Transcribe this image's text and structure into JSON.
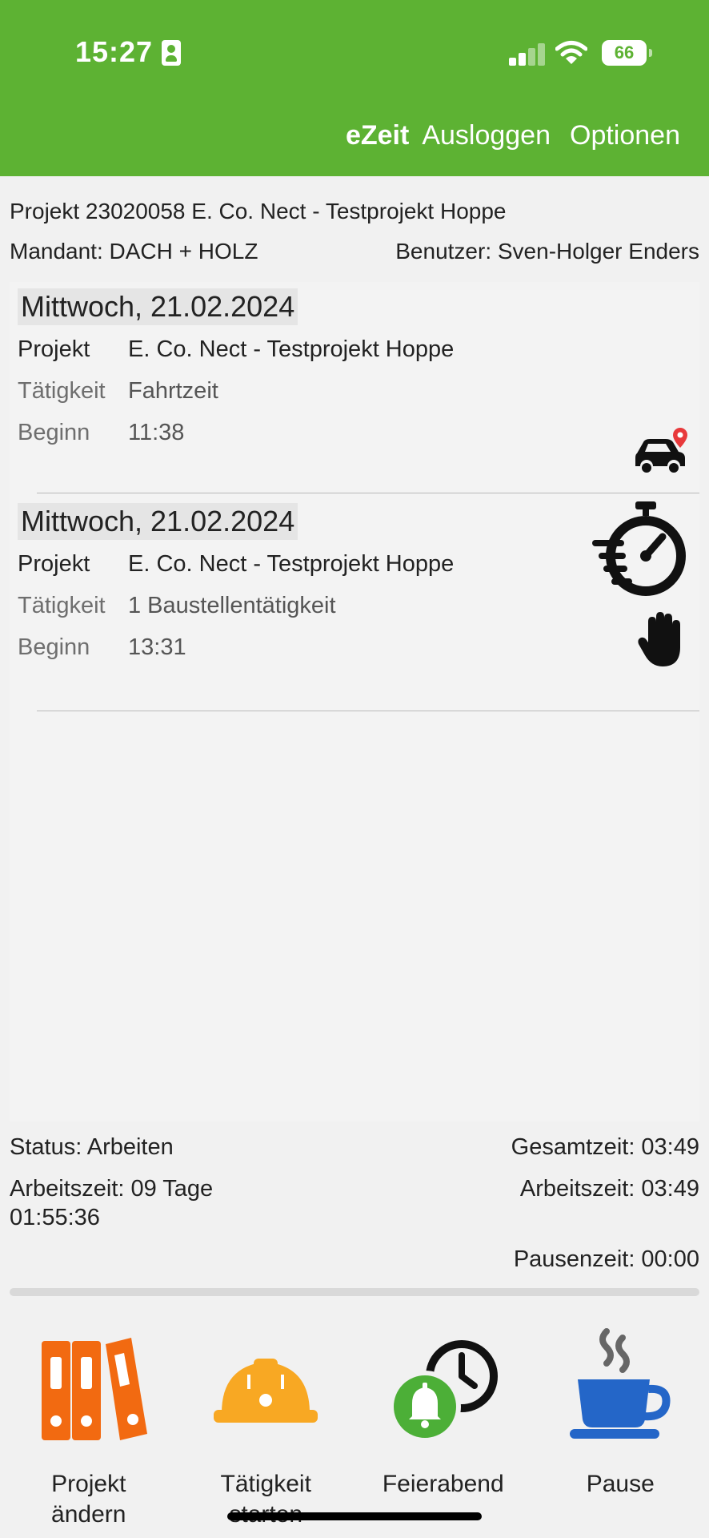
{
  "status_bar": {
    "time": "15:27",
    "battery": "66"
  },
  "nav": {
    "brand": "eZeit",
    "logout": "Ausloggen",
    "options": "Optionen"
  },
  "header": {
    "project": "Projekt 23020058 E. Co. Nect - Testprojekt Hoppe",
    "mandant": "Mandant: DACH + HOLZ",
    "user": "Benutzer: Sven-Holger Enders"
  },
  "entries": [
    {
      "date": "Mittwoch, 21.02.2024",
      "project_label": "Projekt",
      "project": "E. Co. Nect - Testprojekt Hoppe",
      "activity_label": "Tätigkeit",
      "activity": "Fahrtzeit",
      "start_label": "Beginn",
      "start": "11:38",
      "icon": "car-location-icon"
    },
    {
      "date": "Mittwoch, 21.02.2024",
      "project_label": "Projekt",
      "project": "E. Co. Nect - Testprojekt Hoppe",
      "activity_label": "Tätigkeit",
      "activity": "1 Baustellentätigkeit",
      "start_label": "Beginn",
      "start": "13:31",
      "icon": "stopwatch-icon"
    }
  ],
  "status": {
    "state": "Status: Arbeiten",
    "work_days_line1": "Arbeitszeit: 09 Tage",
    "work_days_line2": "01:55:36",
    "total": "Gesamtzeit: 03:49",
    "work": "Arbeitszeit: 03:49",
    "pause": "Pausenzeit: 00:00"
  },
  "actions": [
    {
      "line1": "Projekt",
      "line2": "ändern",
      "icon": "folders-icon",
      "color": "#f26a11"
    },
    {
      "line1": "Tätigkeit",
      "line2": "starten",
      "icon": "hard-hat-icon",
      "color": "#f8a823"
    },
    {
      "line1": "Feierabend",
      "line2": "",
      "icon": "clock-bell-icon",
      "color": "#4caf37"
    },
    {
      "line1": "Pause",
      "line2": "",
      "icon": "coffee-cup-icon",
      "color": "#2466c8"
    }
  ]
}
